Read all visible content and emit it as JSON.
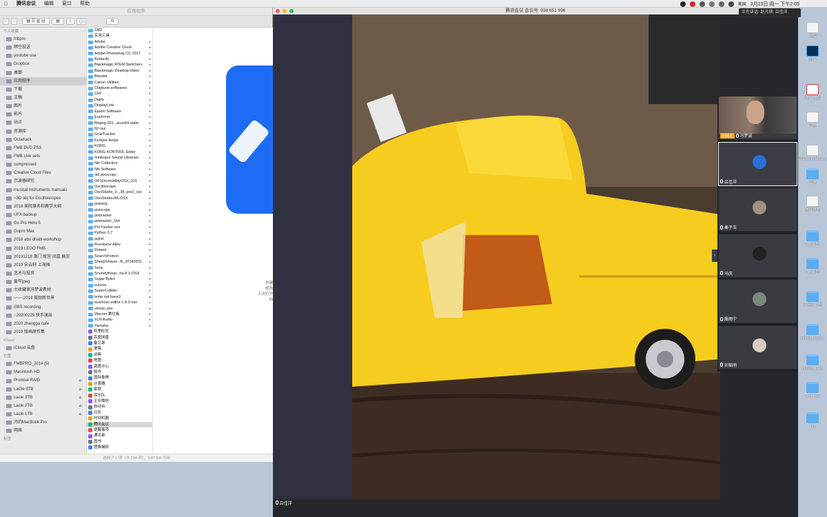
{
  "menubar": {
    "app": "腾讯会议",
    "items": [
      "编辑",
      "窗口",
      "帮助"
    ],
    "datetime": "3月23日 周一 下午2:05",
    "input_source": "美国"
  },
  "speaking": {
    "label": "正在讲话:",
    "names": "赵凡琪; 吕佳洋"
  },
  "finder": {
    "title": "应用程序",
    "status": "选择了 1 项（共 224 项），3.87 GB 可用",
    "sidebar": {
      "favorites_header": "个人收藏",
      "favorites": [
        "fnbpro",
        "隔空投送",
        "youtube use",
        "Dropbox",
        "桌面",
        "应用程序",
        "下载",
        "文稿",
        "图片",
        "影片",
        "站点",
        "资源库",
        "Octatrack",
        "FMB DVD PS3",
        "FMB Live sets",
        "compressed",
        "Creative Cloud Files",
        "示波器研究",
        "musical instruments manuals",
        "~3D obj for Oscilloscopes",
        "2018 美院事务和教学大纲",
        "UFX backup",
        "Go Pro Hero 5",
        "Gopro Max",
        "2018 abu dhabi workshop",
        "2019 LEGO FMB",
        "20191218 澳门 故宫 凤凰 展览",
        "2019 朵云轩 上海摊",
        "艺术与投资",
        "童年jpeg",
        "大收藏家冯梦波素材",
        "~~~~2019 美丽新世界",
        "OBS recording",
        "~20200229 快手演出",
        "2020 zhangga cafe",
        "2019 版画原作集"
      ],
      "icloud_header": "iCloud",
      "icloud": [
        "iCloud 云盘"
      ],
      "locations_header": "位置",
      "locations": [
        "FMBPRO_2014 (5)",
        "Macintosh HD",
        "Promise RAID",
        "LaCie 6TB",
        "Lacie 3TB",
        "Lacie 2TB",
        "Lacie 1TB",
        "冯的MacBook Pro",
        "网络"
      ],
      "tags_header": "标签"
    },
    "apps": [
      "SM2",
      "实用工具",
      "Adobe",
      "Adobe Creative Cloud",
      "Adobe Photoshop CC 2017",
      "Audacity",
      "Blackmagic ATEM Switchers",
      "Blackmagic Desktop Video",
      "Blender",
      "Canon Utilities",
      "Chiptune softwares",
      "Ctrlr",
      "Digits",
      "DisplayLink",
      "Epson Software",
      "Euphonix",
      "ffmpeg-201...acos64-static",
      "ft2-osx",
      "GoatTracker",
      "Kemper Amps",
      "KORG",
      "KORG KONTROL Editor",
      "minilogue Sound Librarian",
      "Nik Collection",
      "Nik Software",
      "old pixiscope",
      "OP1DrumUtilityOSX_101",
      "Oscilloscope",
      "OsciStudio_0...38_pre2_osx",
      "OsciStudio-A5-OSX",
      "pixilang",
      "pixiscope",
      "pixitracker",
      "pixitracker_1bit",
      "ProTracker-osx",
      "Python 3.7",
      "qvjhd",
      "Resolume Alley",
      "Roland",
      "SearchProtect",
      "SheepShaver...B_20140201",
      "Sony",
      "Soundythingi...ha-8.1-OSX",
      "Sugar Bytes",
      "sunvox",
      "SuperCollider",
      "temp out base3",
      "touchosc-editor-1.8.0-osx",
      "virtual_ans",
      "Wacom 数位板",
      "XLN Audio",
      "Yamaha",
      "阿里旺旺",
      "百度网盘",
      "备忘录",
      "便笺",
      "词典",
      "地图",
      "调度中心",
      "股市",
      "国际象棋",
      "计算器",
      "家庭",
      "库乐队",
      "企业微信",
      "启动台",
      "日历",
      "时间机器",
      "腾讯会议",
      "提醒事项",
      "通讯录",
      "图书",
      "图像捕捉"
    ],
    "selected_app": "腾讯会议",
    "preview_meta": [
      "创建",
      "修改",
      "上次打开",
      "标"
    ]
  },
  "meeting": {
    "title": "腾讯会议 会议号: 938 651 996",
    "self_name": "吕佳洋",
    "collapse_glyph": "›",
    "participants": [
      {
        "name": "冯梦波",
        "host_tag": "主持人",
        "has_video": true
      },
      {
        "name": "吕佳洋",
        "host_tag": "",
        "has_video": false
      },
      {
        "name": "秦子玉",
        "host_tag": "",
        "has_video": false
      },
      {
        "name": "马庆",
        "host_tag": "",
        "has_video": false
      },
      {
        "name": "殷雨宁",
        "host_tag": "",
        "has_video": false
      },
      {
        "name": "刘韬明",
        "host_tag": "",
        "has_video": false
      }
    ]
  },
  "desktop": {
    "icons": [
      "文稿",
      "图像",
      "PDF 文稿",
      "音乐",
      "Playground.playground",
      "其他",
      "屏幕快照",
      "h_q截图",
      "h_q截图",
      "丁漫画截图",
      "mdeck_keys 2",
      "mdeck_keys",
      "emp out",
      "key"
    ]
  },
  "colors": {
    "accent": "#1e6cf5",
    "meeting_bg": "#26272c",
    "host_tag": "#f5a623",
    "car_yellow": "#f6cc1e"
  }
}
